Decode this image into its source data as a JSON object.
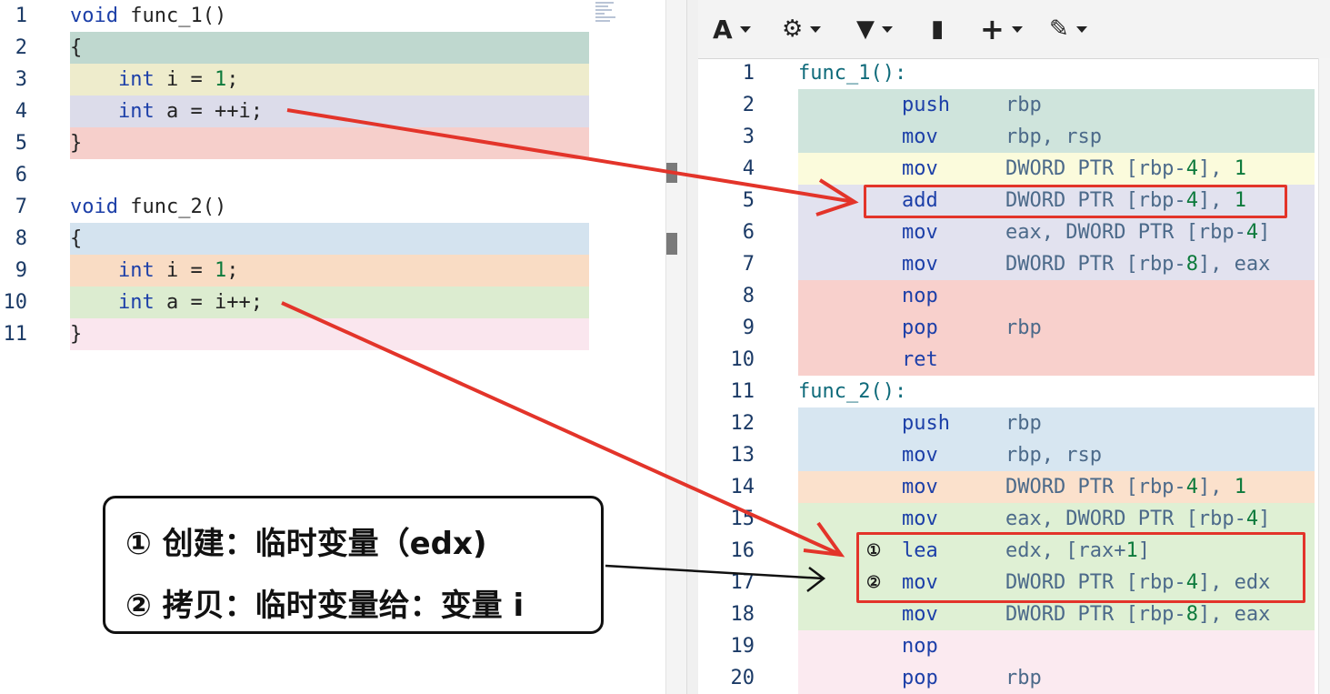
{
  "source_editor": {
    "lines": [
      {
        "n": "1",
        "text": "void func_1()",
        "bg": ""
      },
      {
        "n": "2",
        "text": "{",
        "bg": "#bfd8cf"
      },
      {
        "n": "3",
        "text": "    int i = 1;",
        "bg": "#eeeccc"
      },
      {
        "n": "4",
        "text": "    int a = ++i;",
        "bg": "#dcdcea"
      },
      {
        "n": "5",
        "text": "}",
        "bg": "#f6cfcb"
      },
      {
        "n": "6",
        "text": "",
        "bg": ""
      },
      {
        "n": "7",
        "text": "void func_2()",
        "bg": ""
      },
      {
        "n": "8",
        "text": "{",
        "bg": "#d4e3ef"
      },
      {
        "n": "9",
        "text": "    int i = 1;",
        "bg": "#f9dcc4"
      },
      {
        "n": "10",
        "text": "    int a = i++;",
        "bg": "#dcecd0"
      },
      {
        "n": "11",
        "text": "}",
        "bg": "#fae6ee"
      }
    ]
  },
  "toolbar": {
    "items": [
      {
        "name": "font-size-icon",
        "glyph": "A"
      },
      {
        "name": "settings-icon",
        "glyph": "⚙"
      },
      {
        "name": "filter-icon",
        "glyph": "▼"
      },
      {
        "name": "book-icon",
        "glyph": "▮"
      },
      {
        "name": "add-icon",
        "glyph": "+"
      },
      {
        "name": "brush-icon",
        "glyph": "✎"
      }
    ]
  },
  "assembly": {
    "lines": [
      {
        "n": "1",
        "label": "func_1():",
        "op": "",
        "args": "",
        "bg": ""
      },
      {
        "n": "2",
        "op": "push",
        "args": "rbp",
        "bg": "#cfe4dc"
      },
      {
        "n": "3",
        "op": "mov",
        "args": "rbp, rsp",
        "bg": "#cfe4dc"
      },
      {
        "n": "4",
        "op": "mov",
        "args": "DWORD PTR [rbp-4], 1",
        "bg": "#fbfbdc"
      },
      {
        "n": "5",
        "op": "add",
        "args": "DWORD PTR [rbp-4], 1",
        "bg": "#e2e2ef"
      },
      {
        "n": "6",
        "op": "mov",
        "args": "eax, DWORD PTR [rbp-4]",
        "bg": "#e2e2ef"
      },
      {
        "n": "7",
        "op": "mov",
        "args": "DWORD PTR [rbp-8], eax",
        "bg": "#e2e2ef"
      },
      {
        "n": "8",
        "op": "nop",
        "args": "",
        "bg": "#f8d0cc"
      },
      {
        "n": "9",
        "op": "pop",
        "args": "rbp",
        "bg": "#f8d0cc"
      },
      {
        "n": "10",
        "op": "ret",
        "args": "",
        "bg": "#f8d0cc"
      },
      {
        "n": "11",
        "label": "func_2():",
        "op": "",
        "args": "",
        "bg": ""
      },
      {
        "n": "12",
        "op": "push",
        "args": "rbp",
        "bg": "#d7e6f1"
      },
      {
        "n": "13",
        "op": "mov",
        "args": "rbp, rsp",
        "bg": "#d7e6f1"
      },
      {
        "n": "14",
        "op": "mov",
        "args": "DWORD PTR [rbp-4], 1",
        "bg": "#fbe1cc"
      },
      {
        "n": "15",
        "op": "mov",
        "args": "eax, DWORD PTR [rbp-4]",
        "bg": "#dff0d4"
      },
      {
        "n": "16",
        "circ": "①",
        "op": "lea",
        "args": "edx, [rax+1]",
        "bg": "#dff0d4"
      },
      {
        "n": "17",
        "circ": "②",
        "op": "mov",
        "args": "DWORD PTR [rbp-4], edx",
        "bg": "#dff0d4"
      },
      {
        "n": "18",
        "op": "mov",
        "args": "DWORD PTR [rbp-8], eax",
        "bg": "#dff0d4"
      },
      {
        "n": "19",
        "op": "nop",
        "args": "",
        "bg": "#fbeaf0"
      },
      {
        "n": "20",
        "op": "pop",
        "args": "rbp",
        "bg": "#fbeaf0"
      }
    ]
  },
  "callout": {
    "line1": "① 创建：临时变量（edx)",
    "line2": "② 拷贝：临时变量给：变量 i"
  },
  "colors": {
    "annotation_red": "#e3342a",
    "annotation_black": "#111111"
  }
}
